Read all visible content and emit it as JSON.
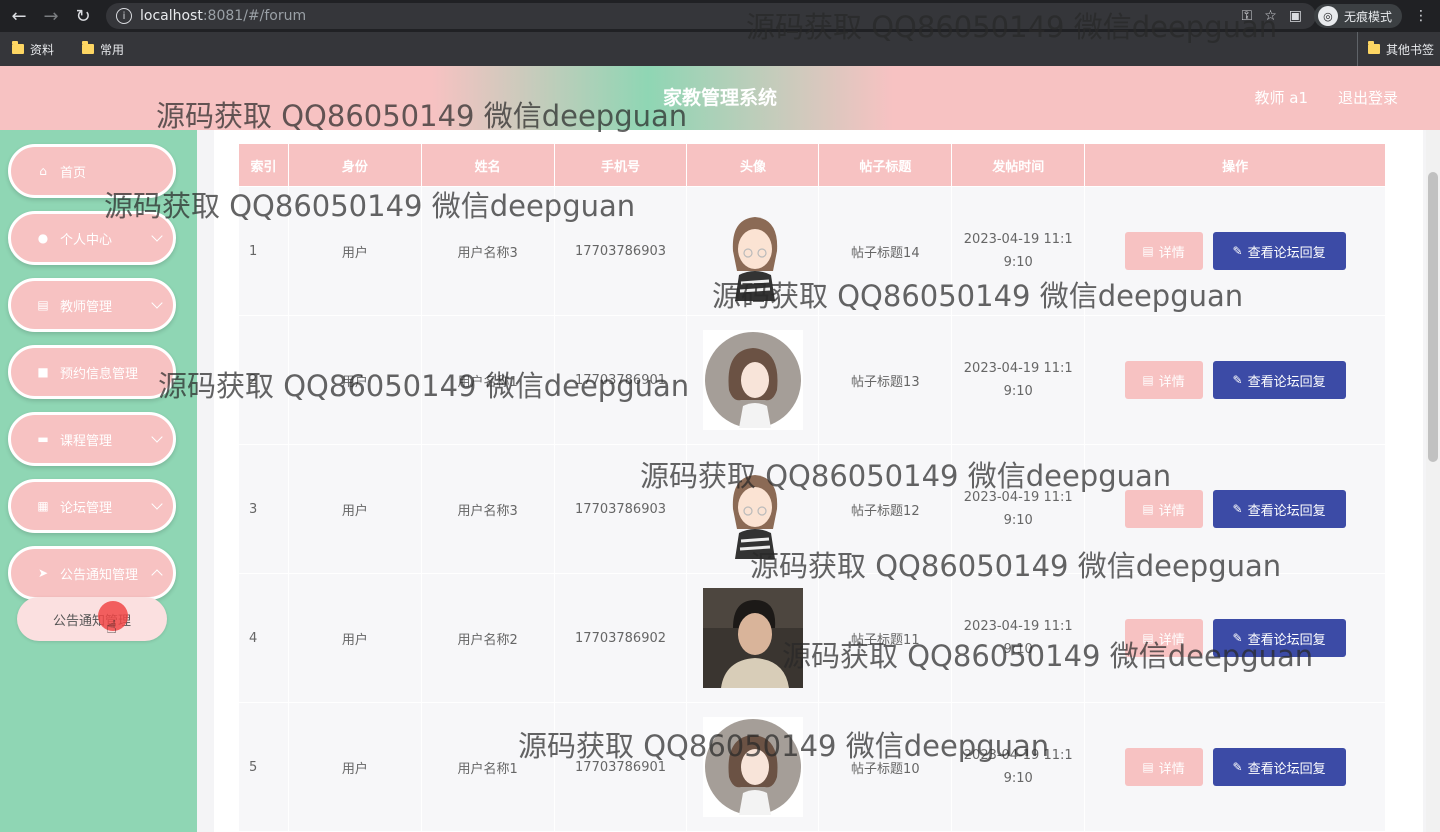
{
  "browser": {
    "url_host": "localhost",
    "url_rest": ":8081/#/forum",
    "incognito_label": "无痕模式",
    "bookmarks": [
      "资料",
      "常用"
    ],
    "other_bookmarks": "其他书签"
  },
  "header": {
    "title": "家教管理系统",
    "user": "教师 a1",
    "logout": "退出登录"
  },
  "sidebar": {
    "items": [
      {
        "label": "首页",
        "icon": "home-icon"
      },
      {
        "label": "个人中心",
        "icon": "user-icon"
      },
      {
        "label": "教师管理",
        "icon": "file-icon"
      },
      {
        "label": "预约信息管理",
        "icon": "video-icon"
      },
      {
        "label": "课程管理",
        "icon": "briefcase-icon"
      },
      {
        "label": "论坛管理",
        "icon": "grid-icon"
      },
      {
        "label": "公告通知管理",
        "icon": "send-icon"
      }
    ],
    "submenu": "公告通知管理"
  },
  "table": {
    "columns": [
      "索引",
      "身份",
      "姓名",
      "手机号",
      "头像",
      "帖子标题",
      "发帖时间",
      "操作"
    ],
    "rows": [
      {
        "index": "1",
        "role": "用户",
        "name": "用户名称3",
        "phone": "17703786903",
        "avatar": "cartoon-girl-glasses",
        "title": "帖子标题14",
        "time_1": "2023-04-19 11:1",
        "time_2": "9:10"
      },
      {
        "index": "2",
        "role": "用户",
        "name": "用户名称1",
        "phone": "17703786901",
        "avatar": "girl-illustration",
        "title": "帖子标题13",
        "time_1": "2023-04-19 11:1",
        "time_2": "9:10"
      },
      {
        "index": "3",
        "role": "用户",
        "name": "用户名称3",
        "phone": "17703786903",
        "avatar": "cartoon-girl-glasses",
        "title": "帖子标题12",
        "time_1": "2023-04-19 11:1",
        "time_2": "9:10"
      },
      {
        "index": "4",
        "role": "用户",
        "name": "用户名称2",
        "phone": "17703786902",
        "avatar": "boy-photo",
        "title": "帖子标题11",
        "time_1": "2023-04-19 11:1",
        "time_2": "9:10"
      },
      {
        "index": "5",
        "role": "用户",
        "name": "用户名称1",
        "phone": "17703786901",
        "avatar": "girl-illustration",
        "title": "帖子标题10",
        "time_1": "2023-04-19 11:1",
        "time_2": "9:10"
      }
    ],
    "detail_label": "详情",
    "reply_label": "查看论坛回复"
  },
  "watermark": "源码获取 QQ86050149 微信deepguan",
  "colors": {
    "pink": "#f7c2c2",
    "green": "#8fd6b4",
    "blue_button": "#3c4ba6"
  }
}
